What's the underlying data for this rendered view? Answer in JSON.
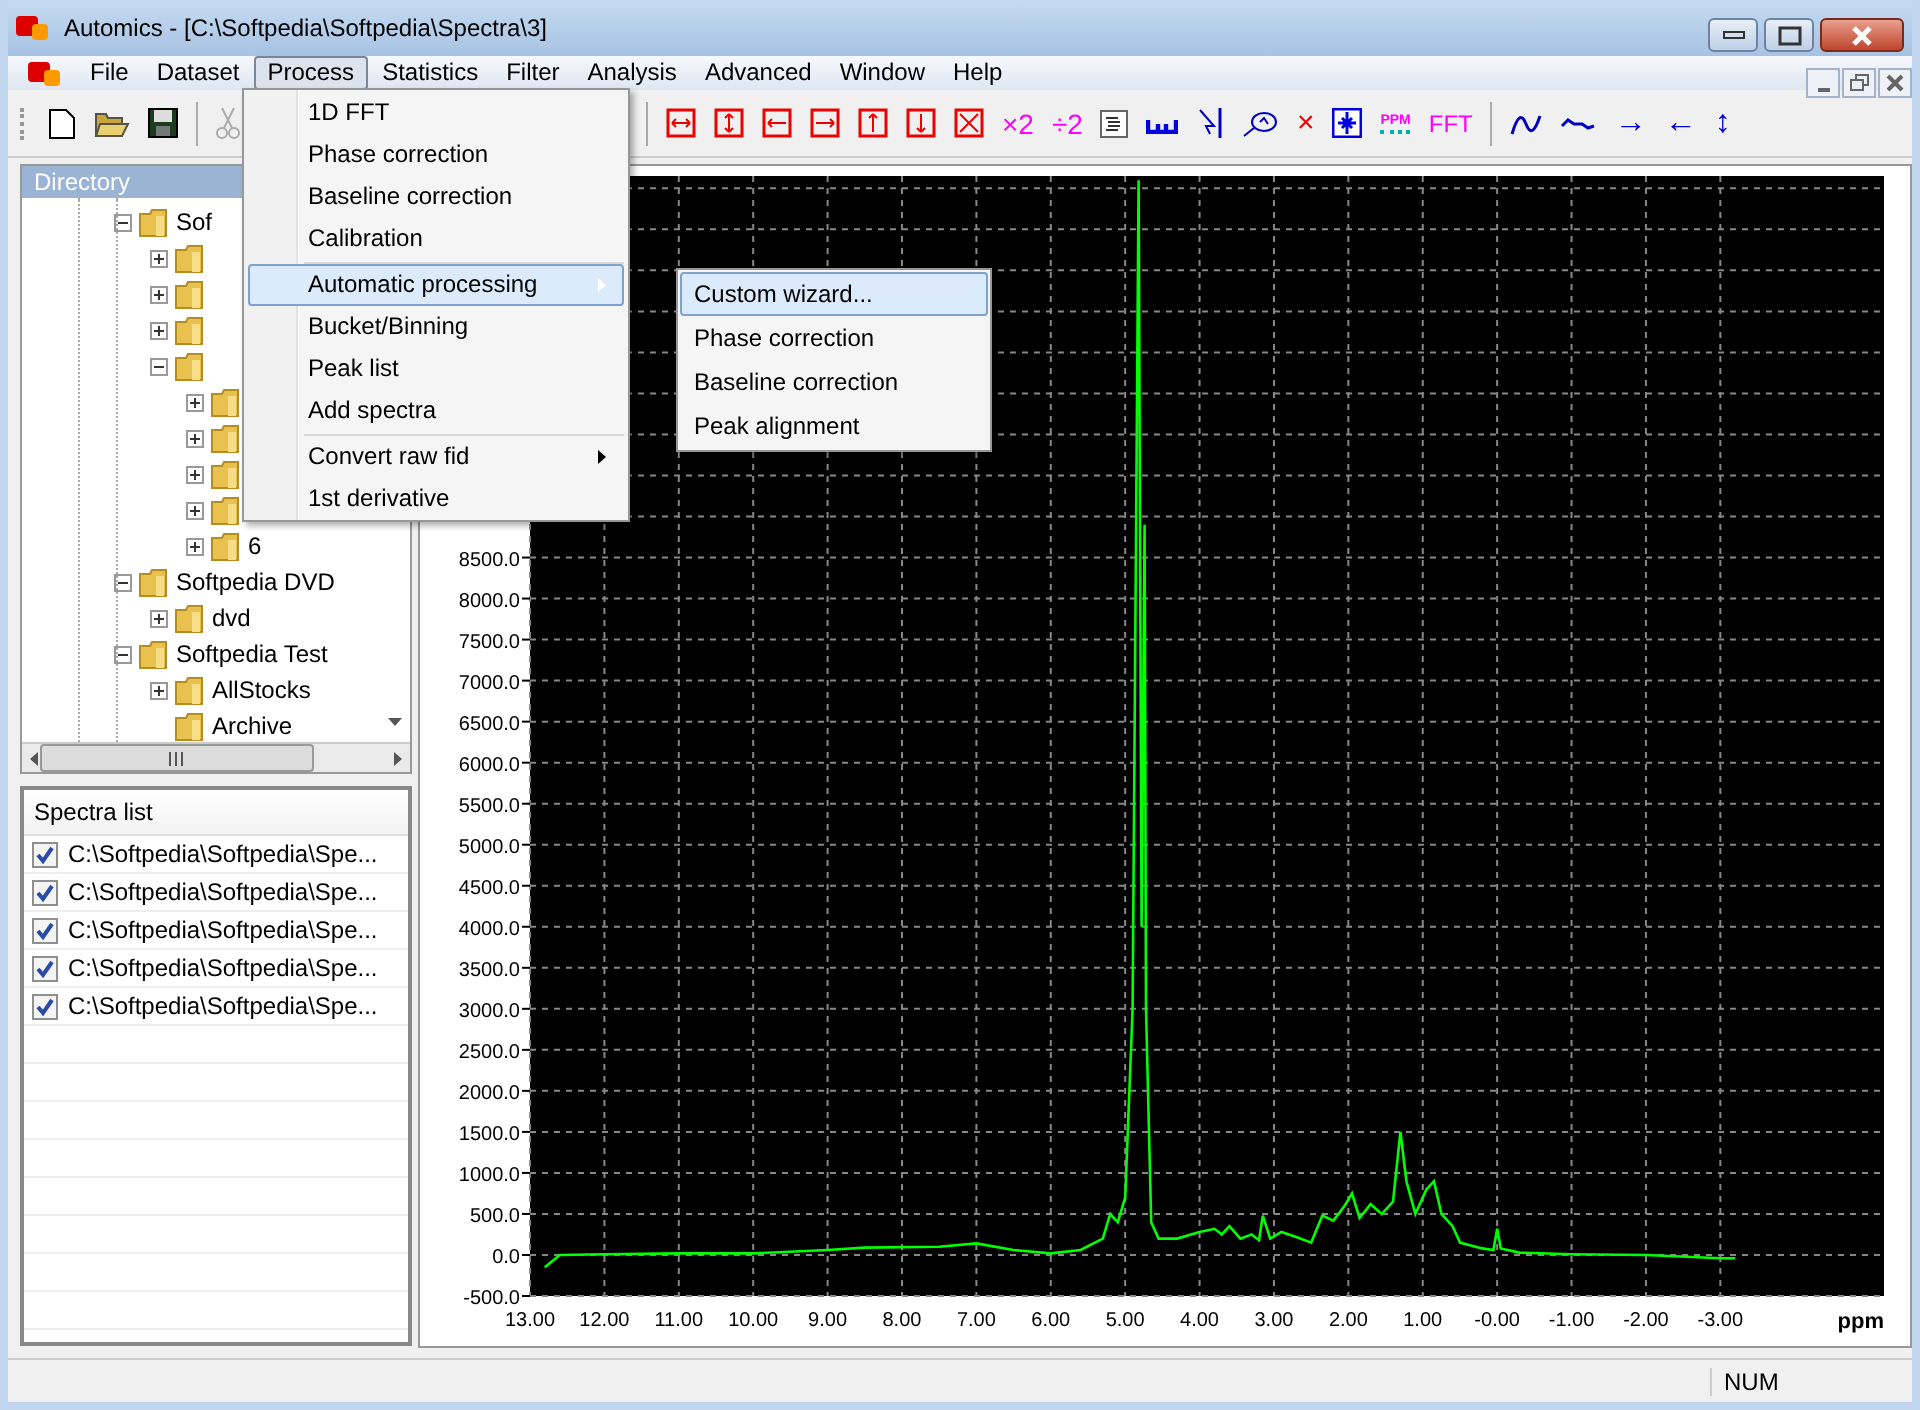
{
  "window": {
    "title": "Automics - [C:\\Softpedia\\Softpedia\\Spectra\\3]"
  },
  "menubar": [
    {
      "label": "File",
      "selected": false
    },
    {
      "label": "Dataset",
      "selected": false
    },
    {
      "label": "Process",
      "selected": true
    },
    {
      "label": "Statistics",
      "selected": false
    },
    {
      "label": "Filter",
      "selected": false
    },
    {
      "label": "Analysis",
      "selected": false
    },
    {
      "label": "Advanced",
      "selected": false
    },
    {
      "label": "Window",
      "selected": false
    },
    {
      "label": "Help",
      "selected": false
    }
  ],
  "toolbar": {
    "cut": {
      "disabled": true
    },
    "scale_buttons": [
      "×2",
      "÷2"
    ],
    "delete": "×",
    "ppm": "PPM",
    "fft": "FFT",
    "arrows": [
      "→",
      "←",
      "↕"
    ]
  },
  "process_menu": [
    {
      "kind": "item",
      "label": "1D FFT",
      "selected": false,
      "submenu": false
    },
    {
      "kind": "item",
      "label": "Phase correction",
      "selected": false,
      "submenu": false
    },
    {
      "kind": "item",
      "label": "Baseline correction",
      "selected": false,
      "submenu": false
    },
    {
      "kind": "item",
      "label": "Calibration",
      "selected": false,
      "submenu": false
    },
    {
      "kind": "separator"
    },
    {
      "kind": "item",
      "label": "Automatic processing",
      "selected": true,
      "submenu": true
    },
    {
      "kind": "item",
      "label": "Bucket/Binning",
      "selected": false,
      "submenu": false
    },
    {
      "kind": "item",
      "label": "Peak list",
      "selected": false,
      "submenu": false
    },
    {
      "kind": "item",
      "label": "Add spectra",
      "selected": false,
      "submenu": false
    },
    {
      "kind": "separator"
    },
    {
      "kind": "item",
      "label": "Convert raw fid",
      "selected": false,
      "submenu": true
    },
    {
      "kind": "item",
      "label": "1st derivative",
      "selected": false,
      "submenu": false
    }
  ],
  "submenu": [
    {
      "label": "Custom wizard...",
      "selected": true
    },
    {
      "label": "Phase correction",
      "selected": false
    },
    {
      "label": "Baseline correction",
      "selected": false
    },
    {
      "label": "Peak alignment",
      "selected": false
    }
  ],
  "directory": {
    "title": "Directory",
    "items": [
      {
        "label": "Sof",
        "expanded": true,
        "children": [
          {
            "expanded": false
          },
          {
            "expanded": false
          },
          {
            "expanded": false
          },
          {
            "expanded": true,
            "children": [
              {
                "expanded": false
              },
              {
                "expanded": false
              },
              {
                "expanded": false
              },
              {
                "expanded": false
              },
              {
                "label": "6",
                "expanded": false
              }
            ]
          }
        ]
      },
      {
        "label": "Softpedia DVD",
        "expanded": true,
        "children": [
          {
            "label": "dvd",
            "expanded": false
          }
        ]
      },
      {
        "label": "Softpedia Test",
        "expanded": true,
        "children": [
          {
            "label": "AllStocks",
            "expanded": false
          },
          {
            "label": "Archive"
          }
        ]
      }
    ]
  },
  "spectra_list": {
    "title": "Spectra list",
    "items": [
      {
        "label": "C:\\Softpedia\\Softpedia\\Spe...",
        "checked": true
      },
      {
        "label": "C:\\Softpedia\\Softpedia\\Spe...",
        "checked": true
      },
      {
        "label": "C:\\Softpedia\\Softpedia\\Spe...",
        "checked": true
      },
      {
        "label": "C:\\Softpedia\\Softpedia\\Spe...",
        "checked": true
      },
      {
        "label": "C:\\Softpedia\\Softpedia\\Spe...",
        "checked": true
      }
    ]
  },
  "chart_data": {
    "type": "line",
    "xlabel": "ppm",
    "x": [
      12.8,
      12.6,
      12,
      11,
      10,
      9,
      8.5,
      7.5,
      7,
      6.5,
      6,
      5.6,
      5.3,
      5.2,
      5.1,
      5.0,
      4.9,
      4.82,
      4.78,
      4.74,
      4.72,
      4.65,
      4.55,
      4.3,
      4.0,
      3.8,
      3.7,
      3.6,
      3.45,
      3.3,
      3.2,
      3.15,
      3.05,
      2.9,
      2.7,
      2.5,
      2.35,
      2.2,
      2.05,
      1.95,
      1.85,
      1.7,
      1.55,
      1.4,
      1.3,
      1.22,
      1.1,
      0.95,
      0.85,
      0.75,
      0.6,
      0.5,
      0.2,
      0.05,
      0.0,
      -0.05,
      -0.3,
      -1,
      -2,
      -3,
      -3.2
    ],
    "series": [
      {
        "color": "#00ff00",
        "values": [
          -150,
          0,
          10,
          20,
          20,
          60,
          90,
          100,
          140,
          60,
          20,
          60,
          200,
          500,
          400,
          700,
          3000,
          13100,
          4000,
          8900,
          3000,
          400,
          200,
          200,
          280,
          320,
          250,
          350,
          200,
          250,
          180,
          480,
          200,
          280,
          220,
          150,
          480,
          420,
          600,
          750,
          450,
          620,
          500,
          650,
          1500,
          900,
          500,
          800,
          900,
          500,
          350,
          150,
          80,
          60,
          320,
          80,
          30,
          10,
          0,
          -40,
          -40
        ]
      }
    ],
    "grid": true,
    "xlim": [
      13,
      -5.2
    ],
    "ylim": [
      -500,
      13150
    ],
    "xticks": [
      {
        "value": 13,
        "label": "13.00"
      },
      {
        "value": 12,
        "label": "12.00"
      },
      {
        "value": 11,
        "label": "11.00"
      },
      {
        "value": 10,
        "label": "10.00"
      },
      {
        "value": 9,
        "label": "9.00"
      },
      {
        "value": 8,
        "label": "8.00"
      },
      {
        "value": 7,
        "label": "7.00"
      },
      {
        "value": 6,
        "label": "6.00"
      },
      {
        "value": 5,
        "label": "5.00"
      },
      {
        "value": 4,
        "label": "4.00"
      },
      {
        "value": 3,
        "label": "3.00"
      },
      {
        "value": 2,
        "label": "2.00"
      },
      {
        "value": 1,
        "label": "1.00"
      },
      {
        "value": 0,
        "label": "-0.00"
      },
      {
        "value": -1,
        "label": "-1.00"
      },
      {
        "value": -2,
        "label": "-2.00"
      },
      {
        "value": -3,
        "label": "-3.00"
      }
    ],
    "yticks": [
      {
        "value": -500,
        "label": "-500.0"
      },
      {
        "value": 0,
        "label": "0.0"
      },
      {
        "value": 500,
        "label": "500.0"
      },
      {
        "value": 1000,
        "label": "1000.0"
      },
      {
        "value": 1500,
        "label": "1500.0"
      },
      {
        "value": 2000,
        "label": "2000.0"
      },
      {
        "value": 2500,
        "label": "2500.0"
      },
      {
        "value": 3000,
        "label": "3000.0"
      },
      {
        "value": 3500,
        "label": "3500.0"
      },
      {
        "value": 4000,
        "label": "4000.0"
      },
      {
        "value": 4500,
        "label": "4500.0"
      },
      {
        "value": 5000,
        "label": "5000.0"
      },
      {
        "value": 5500,
        "label": "5500.0"
      },
      {
        "value": 6000,
        "label": "6000.0"
      },
      {
        "value": 6500,
        "label": "6500.0"
      },
      {
        "value": 7000,
        "label": "7000.0"
      },
      {
        "value": 7500,
        "label": "7500.0"
      },
      {
        "value": 8000,
        "label": "8000.0"
      },
      {
        "value": 8500,
        "label": "8500.0"
      }
    ]
  },
  "status_bar": {
    "num": "NUM"
  }
}
